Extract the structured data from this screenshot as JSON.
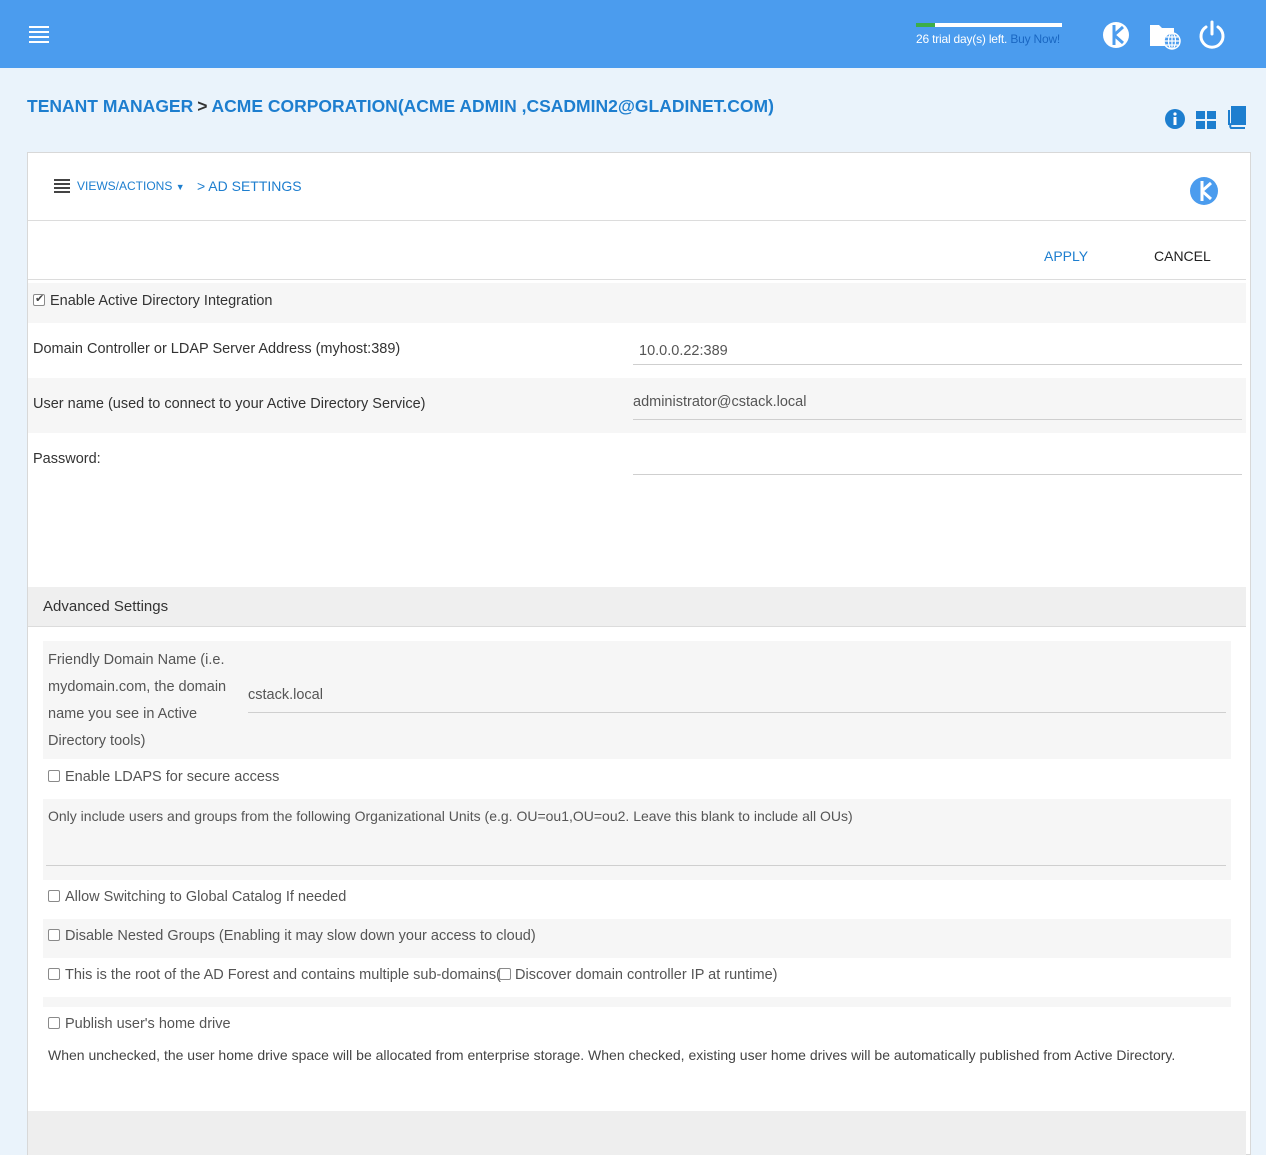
{
  "colors": {
    "topbar": "#4b9cee",
    "accent": "#1d7ecf",
    "trial_progress": "#3cae48"
  },
  "topbar": {
    "menu_icon": "hamburger-menu-icon",
    "trial_fraction": 0.13,
    "trial_text": "26 trial day(s) left.",
    "buy_now": "Buy Now!",
    "icons": [
      "brand-logo-icon",
      "folder-globe-icon",
      "power-icon"
    ]
  },
  "header": {
    "crumb_root": "TENANT MANAGER",
    "separator": ">",
    "crumb_tenant": "ACME CORPORATION(ACME ADMIN ,CSADMIN2@GLADINET.COM)",
    "icons": [
      "info-icon",
      "grid-icon",
      "book-icon"
    ]
  },
  "panel": {
    "views_actions": "VIEWS/ACTIONS",
    "crumb_current": "> AD SETTINGS",
    "apply": "APPLY",
    "cancel": "CANCEL"
  },
  "form": {
    "enable_ad_label": "Enable Active Directory Integration",
    "enable_ad_checked": true,
    "ldap_label": "Domain Controller or LDAP Server Address (myhost:389)",
    "ldap_value": "10.0.0.22:389",
    "username_label": "User name (used to connect to your Active Directory Service)",
    "username_value": "administrator@cstack.local",
    "password_label": "Password:",
    "password_value": ""
  },
  "advanced": {
    "title": "Advanced Settings",
    "friendly_label_1": "Friendly Domain Name (i.e.",
    "friendly_label_2": "mydomain.com, the domain",
    "friendly_label_3": "name you see in Active",
    "friendly_label_4": "Directory tools)",
    "friendly_value": "cstack.local",
    "ldaps_label": "Enable LDAPS for secure access",
    "ou_label": "Only include users and groups from the following Organizational Units (e.g. OU=ou1,OU=ou2. Leave this blank to include all OUs)",
    "ou_value": "",
    "global_catalog_label": "Allow Switching to Global Catalog If needed",
    "nested_groups_label": "Disable Nested Groups (Enabling it may slow down your access to cloud)",
    "forest_root_label": "This is the root of the AD Forest and contains multiple sub-domains(",
    "discover_dc_label": "Discover domain controller IP at runtime)",
    "publish_home_label": "Publish user's home drive",
    "publish_home_desc": "When unchecked, the user home drive space will be allocated from enterprise storage. When checked, existing user home drives will be automatically published from Active Directory."
  }
}
